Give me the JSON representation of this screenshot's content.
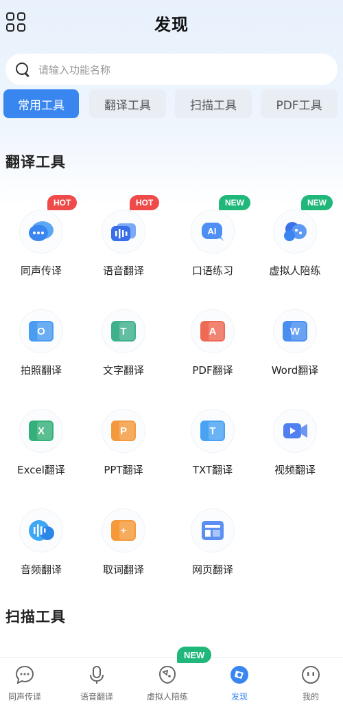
{
  "header": {
    "title": "发现",
    "menu_icon": "grid-icon"
  },
  "search": {
    "placeholder": "请输入功能名称",
    "icon": "search-icon"
  },
  "tabs": [
    {
      "label": "常用工具",
      "active": true
    },
    {
      "label": "翻译工具",
      "active": false
    },
    {
      "label": "扫描工具",
      "active": false
    },
    {
      "label": "PDF工具",
      "active": false
    }
  ],
  "sections": {
    "translate_title": "翻译工具",
    "scan_title": "扫描工具"
  },
  "tools": [
    {
      "label": "同声传译",
      "badge": "HOT",
      "icon": "chat-bubble-icon"
    },
    {
      "label": "语音翻译",
      "badge": "HOT",
      "icon": "voice-translate-icon"
    },
    {
      "label": "口语练习",
      "badge": "NEW",
      "icon": "ai-speech-icon"
    },
    {
      "label": "虚拟人陪练",
      "badge": "NEW",
      "icon": "virtual-human-icon"
    },
    {
      "label": "拍照翻译",
      "icon": "camera-translate-icon",
      "glyph": "O"
    },
    {
      "label": "文字翻译",
      "icon": "text-translate-icon",
      "glyph": "T"
    },
    {
      "label": "PDF翻译",
      "icon": "pdf-translate-icon",
      "glyph": "A"
    },
    {
      "label": "Word翻译",
      "icon": "word-translate-icon",
      "glyph": "W"
    },
    {
      "label": "Excel翻译",
      "icon": "excel-translate-icon",
      "glyph": "X"
    },
    {
      "label": "PPT翻译",
      "icon": "ppt-translate-icon",
      "glyph": "P"
    },
    {
      "label": "TXT翻译",
      "icon": "txt-translate-icon",
      "glyph": "T"
    },
    {
      "label": "视频翻译",
      "icon": "video-translate-icon"
    },
    {
      "label": "音频翻译",
      "icon": "audio-translate-icon"
    },
    {
      "label": "取词翻译",
      "icon": "word-pick-translate-icon",
      "glyph": "+"
    },
    {
      "label": "网页翻译",
      "icon": "webpage-translate-icon"
    }
  ],
  "colors": {
    "accent": "#3a86f0",
    "hot": "#f04b4b",
    "new": "#1fb77a",
    "excel": "#35b07a",
    "ppt": "#f39a3d",
    "pdf": "#ee6a55"
  },
  "bottom_nav": {
    "badge": "NEW",
    "items": [
      {
        "label": "同声传译",
        "icon": "chat-icon",
        "active": false
      },
      {
        "label": "语音翻译",
        "icon": "microphone-icon",
        "active": false
      },
      {
        "label": "虚拟人陪练",
        "icon": "virtual-human-icon",
        "active": false
      },
      {
        "label": "发现",
        "icon": "compass-icon",
        "active": true
      },
      {
        "label": "我的",
        "icon": "profile-icon",
        "active": false
      }
    ]
  }
}
